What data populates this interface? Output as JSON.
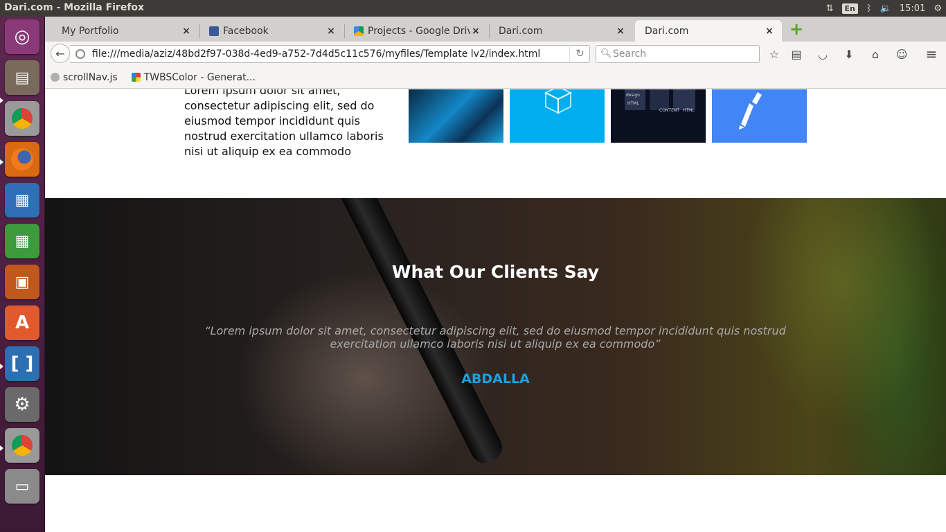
{
  "system": {
    "window_title": "Dari.com - Mozilla Firefox",
    "keyboard_layout": "En",
    "clock": "15:01"
  },
  "launcher": {
    "items": [
      {
        "name": "ubuntu-dash",
        "color": "#8a3a78"
      },
      {
        "name": "files",
        "color": "#7a6a5c"
      },
      {
        "name": "chrome",
        "color": "#9a9a9a"
      },
      {
        "name": "firefox",
        "color": "#d96a12"
      },
      {
        "name": "libreoffice-writer",
        "color": "#2f6fb6"
      },
      {
        "name": "libreoffice-calc",
        "color": "#3d9a3d"
      },
      {
        "name": "libreoffice-impress",
        "color": "#c0581e"
      },
      {
        "name": "software-center",
        "color": "#e2592e"
      },
      {
        "name": "brackets",
        "color": "#2d6fb0"
      },
      {
        "name": "system-settings",
        "color": "#6a6a6a"
      },
      {
        "name": "chrome",
        "color": "#9a9a9a"
      },
      {
        "name": "usb-drive",
        "color": "#8a8a8a"
      }
    ]
  },
  "tabs": [
    {
      "label": "My Portfolio",
      "close": "×"
    },
    {
      "label": "Facebook",
      "close": "×"
    },
    {
      "label": "Projects - Google Drive",
      "close": "×"
    },
    {
      "label": "Dari.com",
      "close": "×"
    },
    {
      "label": "Dari.com",
      "close": "×"
    }
  ],
  "navbar": {
    "url": "file:///media/aziz/48bd2f97-038d-4ed9-a752-7d4d5c11c576/myfiles/Template lv2/index.html",
    "search_placeholder": "Search"
  },
  "bookmarks": [
    {
      "label": "scrollNav.js"
    },
    {
      "label": "TWBSColor - Generat..."
    }
  ],
  "page": {
    "intro_text": "Lorem ipsum dolor sit amet, consectetur adipiscing elit, sed do eiusmod tempor incididunt quis nostrud exercitation ullamco laboris nisi ut aliquip ex ea commodo",
    "testimonials": {
      "title": "What Our Clients Say",
      "quote": "“Lorem ipsum dolor sit amet, consectetur adipiscing elit, sed do eiusmod tempor incididunt quis nostrud exercitation ullamco laboris nisi ut aliquip ex ea commodo”",
      "author": "ABDALLA",
      "accent_color": "#1ba1e2"
    }
  }
}
